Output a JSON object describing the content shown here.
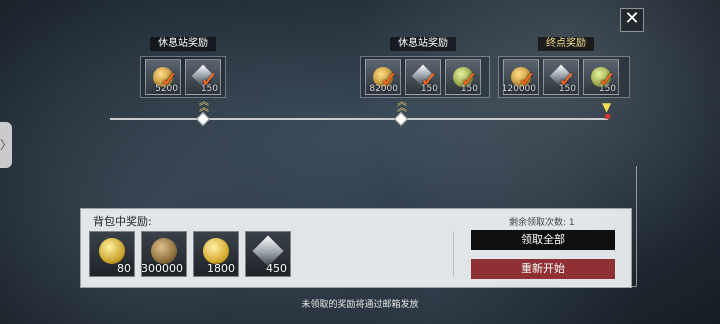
{
  "ui": {
    "close_icon": "✕",
    "side_tab_icon": "〉"
  },
  "stations": [
    {
      "label": "休息站奖励",
      "rewards": [
        {
          "type": "coin",
          "qty": "5200",
          "claimed": true
        },
        {
          "type": "crystal",
          "qty": "150",
          "claimed": true
        }
      ]
    },
    {
      "label": "休息站奖励",
      "rewards": [
        {
          "type": "coin",
          "qty": "82000",
          "claimed": true
        },
        {
          "type": "crystal",
          "qty": "150",
          "claimed": true
        },
        {
          "type": "token",
          "qty": "150",
          "claimed": true
        }
      ]
    },
    {
      "label": "终点奖励",
      "rewards": [
        {
          "type": "coin",
          "qty": "120000",
          "claimed": true
        },
        {
          "type": "crystal",
          "qty": "150",
          "claimed": true
        },
        {
          "type": "token",
          "qty": "150",
          "claimed": true
        }
      ]
    }
  ],
  "bag": {
    "title": "背包中奖励:",
    "remaining_label": "剩余领取次数: 1",
    "items": [
      {
        "type": "wings-coin",
        "qty": "80"
      },
      {
        "type": "silver-coin",
        "qty": "300000"
      },
      {
        "type": "gold-coin",
        "qty": "1800"
      },
      {
        "type": "crystal",
        "qty": "450"
      }
    ],
    "claim_all_label": "领取全部",
    "restart_label": "重新开始"
  },
  "footer": {
    "note": "未领取的奖励将通过邮箱发放"
  },
  "colors": {
    "restart_button": "#8f3034",
    "claim_button": "#0f0f0f",
    "check_mark": "#ff6a1f",
    "final_label_text": "#f3e08a"
  }
}
